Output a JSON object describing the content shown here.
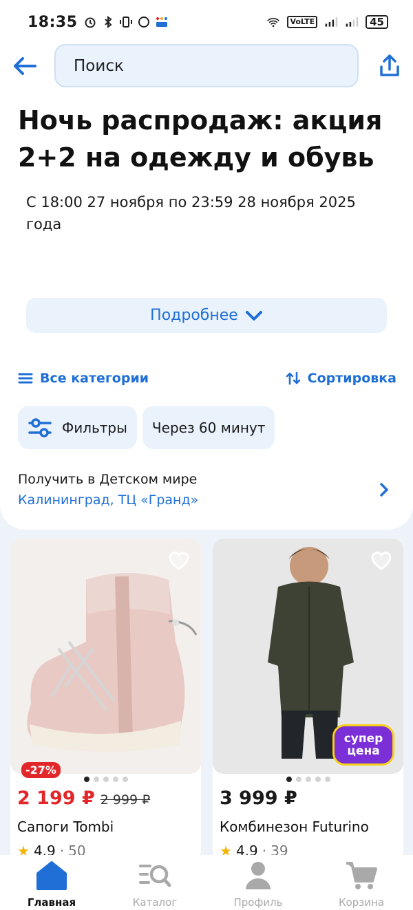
{
  "status_bar": {
    "time": "18:35",
    "volte": "VoLTE",
    "battery": "45"
  },
  "header": {
    "search_placeholder": "Поиск"
  },
  "promo": {
    "title": "Ночь распродаж: акция 2+2 на одежду и обувь",
    "dates": "С 18:00 27 ноября по 23:59 28 ноября 2025 года",
    "more_label": "Подробнее"
  },
  "controls": {
    "categories_label": "Все категории",
    "sort_label": "Сортировка",
    "filters_label": "Фильтры",
    "delivery_chip": "Через 60 минут"
  },
  "pickup": {
    "title": "Получить в Детском мире",
    "location": "Калининград, ТЦ «Гранд»"
  },
  "products": [
    {
      "name": "Сапоги Tombi",
      "price": "2 199 ₽",
      "old_price": "2 999 ₽",
      "discount": "-27%",
      "rating": "4.9",
      "reviews": "50",
      "active_dot": 0,
      "dots": 5
    },
    {
      "name": "Комбинезон Futurino",
      "price": "3 999 ₽",
      "badge_line1": "супер",
      "badge_line2": "цена",
      "rating": "4.9",
      "reviews": "39",
      "active_dot": 0,
      "dots": 5
    }
  ],
  "bottom_nav": [
    {
      "label": "Главная",
      "icon": "home-icon",
      "active": true
    },
    {
      "label": "Каталог",
      "icon": "catalog-search-icon",
      "active": false
    },
    {
      "label": "Профиль",
      "icon": "profile-icon",
      "active": false
    },
    {
      "label": "Корзина",
      "icon": "cart-icon",
      "active": false
    }
  ],
  "colors": {
    "accent": "#1f6fd6",
    "discount": "#e3262a",
    "badge": "#7b2fd6"
  }
}
